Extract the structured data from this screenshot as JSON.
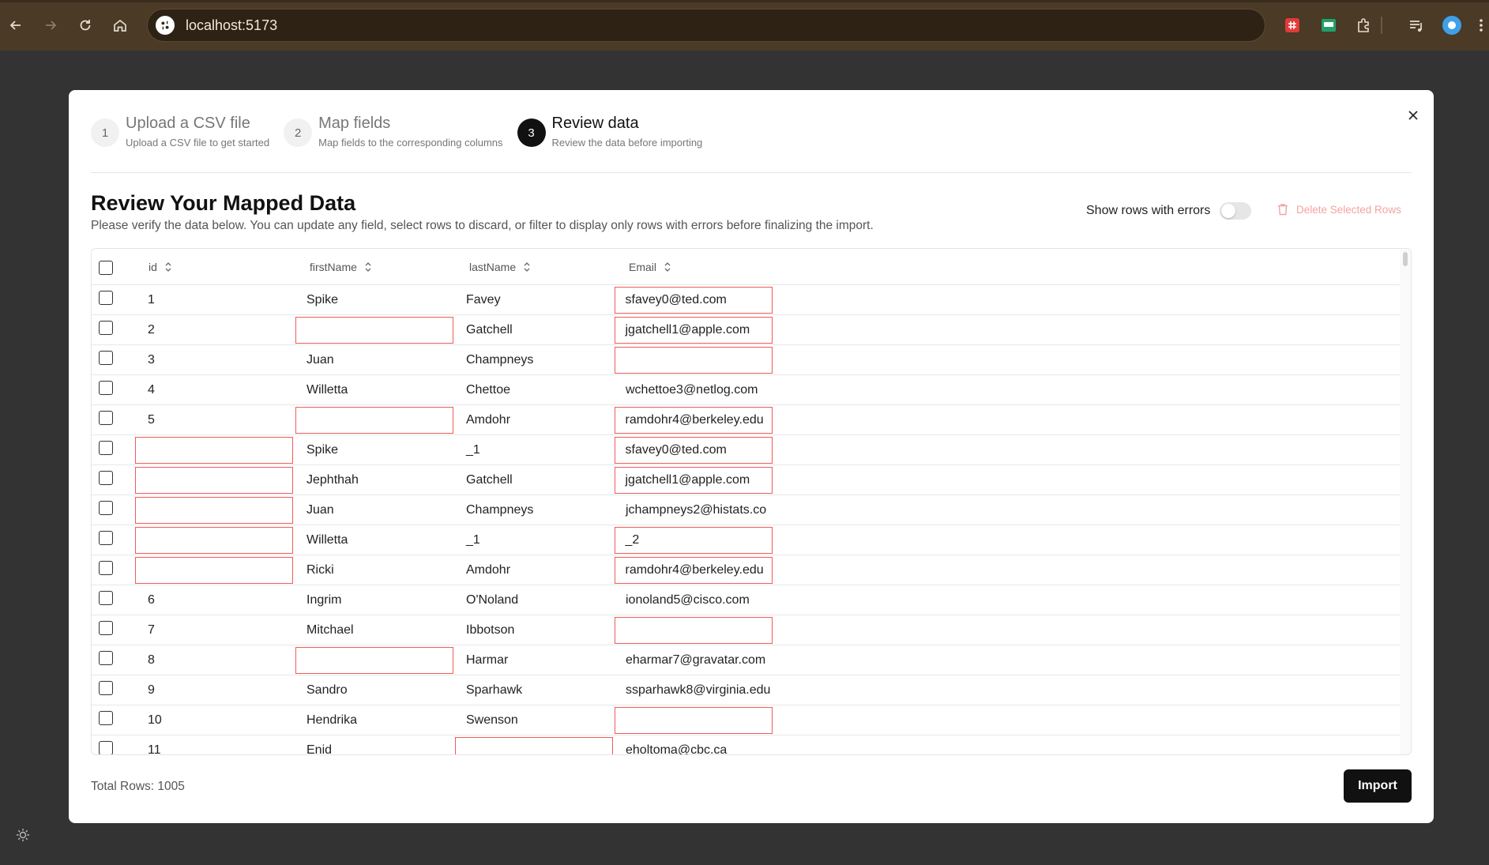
{
  "browser": {
    "url": "localhost:5173",
    "icons": [
      "back-icon",
      "forward-icon",
      "reload-icon",
      "home-icon",
      "site-info-icon",
      "extension-1-icon",
      "extension-2-icon",
      "extensions-puzzle-icon",
      "media-queue-icon",
      "profile-icon",
      "menu-icon"
    ]
  },
  "steps": [
    {
      "num": "1",
      "title": "Upload a CSV file",
      "subtitle": "Upload a CSV file to get started"
    },
    {
      "num": "2",
      "title": "Map fields",
      "subtitle": "Map fields to the corresponding columns"
    },
    {
      "num": "3",
      "title": "Review data",
      "subtitle": "Review the data before importing"
    }
  ],
  "review": {
    "title": "Review Your Mapped Data",
    "description": "Please verify the data below. You can update any field, select rows to discard, or filter to display only rows with errors before finalizing the import.",
    "toggle_label": "Show rows with errors",
    "toggle_on": false,
    "delete_label": "Delete Selected Rows"
  },
  "table": {
    "columns": [
      "id",
      "firstName",
      "lastName",
      "Email"
    ],
    "rows": [
      {
        "id": "1",
        "firstName": "Spike",
        "lastName": "Favey",
        "email": "sfavey0@ted.com",
        "errors": [
          "email"
        ]
      },
      {
        "id": "2",
        "firstName": "",
        "lastName": "Gatchell",
        "email": "jgatchell1@apple.com",
        "errors": [
          "firstName",
          "email"
        ]
      },
      {
        "id": "3",
        "firstName": "Juan",
        "lastName": "Champneys",
        "email": "",
        "errors": [
          "email"
        ]
      },
      {
        "id": "4",
        "firstName": "Willetta",
        "lastName": "Chettoe",
        "email": "wchettoe3@netlog.com",
        "errors": []
      },
      {
        "id": "5",
        "firstName": "",
        "lastName": "Amdohr",
        "email": "ramdohr4@berkeley.edu",
        "errors": [
          "firstName",
          "email"
        ]
      },
      {
        "id": "",
        "firstName": "Spike",
        "lastName": "_1",
        "email": "sfavey0@ted.com",
        "errors": [
          "id",
          "email"
        ]
      },
      {
        "id": "",
        "firstName": "Jephthah",
        "lastName": "Gatchell",
        "email": "jgatchell1@apple.com",
        "errors": [
          "id",
          "email"
        ]
      },
      {
        "id": "",
        "firstName": "Juan",
        "lastName": "Champneys",
        "email": "jchampneys2@histats.co",
        "errors": [
          "id"
        ]
      },
      {
        "id": "",
        "firstName": "Willetta",
        "lastName": "_1",
        "email": "_2",
        "errors": [
          "id",
          "email"
        ]
      },
      {
        "id": "",
        "firstName": "Ricki",
        "lastName": "Amdohr",
        "email": "ramdohr4@berkeley.edu",
        "errors": [
          "id",
          "email"
        ]
      },
      {
        "id": "6",
        "firstName": "Ingrim",
        "lastName": "O'Noland",
        "email": "ionoland5@cisco.com",
        "errors": []
      },
      {
        "id": "7",
        "firstName": "Mitchael",
        "lastName": "Ibbotson",
        "email": "",
        "errors": [
          "email"
        ]
      },
      {
        "id": "8",
        "firstName": "",
        "lastName": "Harmar",
        "email": "eharmar7@gravatar.com",
        "errors": [
          "firstName"
        ]
      },
      {
        "id": "9",
        "firstName": "Sandro",
        "lastName": "Sparhawk",
        "email": "ssparhawk8@virginia.edu",
        "errors": []
      },
      {
        "id": "10",
        "firstName": "Hendrika",
        "lastName": "Swenson",
        "email": "",
        "errors": [
          "email"
        ]
      },
      {
        "id": "11",
        "firstName": "Enid",
        "lastName": "",
        "email": "eholtoma@cbc.ca",
        "errors": [
          "lastName"
        ]
      }
    ]
  },
  "footer": {
    "total_rows": "Total Rows: 1005",
    "import_label": "Import"
  },
  "colors": {
    "error_border": "#ef5b5b",
    "primary": "#111111",
    "delete_text": "#f4a3a3"
  }
}
